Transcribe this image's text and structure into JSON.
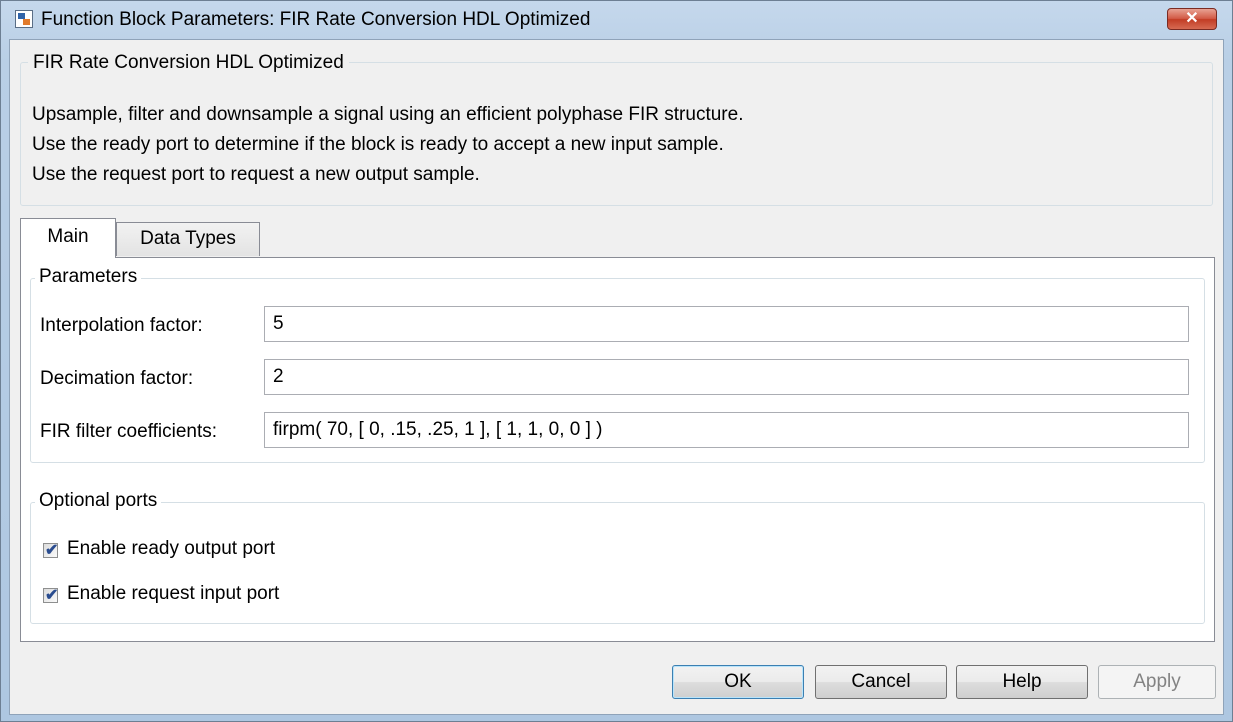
{
  "window": {
    "title": "Function Block Parameters: FIR Rate Conversion HDL Optimized",
    "close_label": "✕"
  },
  "description": {
    "group_title": "FIR Rate Conversion HDL Optimized",
    "lines": [
      "Upsample, filter and downsample a signal using an efficient polyphase FIR structure.",
      "Use the ready port to determine if the block is ready to accept a new input sample.",
      "Use the request port to request a new output sample."
    ]
  },
  "tabs": [
    {
      "label": "Main",
      "active": true
    },
    {
      "label": "Data Types",
      "active": false
    }
  ],
  "parameters": {
    "group_title": "Parameters",
    "interpolation": {
      "label": "Interpolation factor:",
      "value": "5"
    },
    "decimation": {
      "label": "Decimation factor:",
      "value": "2"
    },
    "coefficients": {
      "label": "FIR filter coefficients:",
      "value": "firpm( 70, [ 0, .15, .25, 1 ], [ 1, 1, 0, 0 ] )"
    }
  },
  "optional_ports": {
    "group_title": "Optional ports",
    "ready": {
      "label": "Enable ready output port",
      "checked": true
    },
    "request": {
      "label": "Enable request input port",
      "checked": true
    }
  },
  "buttons": {
    "ok": "OK",
    "cancel": "Cancel",
    "help": "Help",
    "apply": "Apply"
  },
  "icons": {
    "app": "simulink-block-icon",
    "close": "close-icon",
    "check": "checkmark-icon"
  },
  "colors": {
    "title_bar": "#b9cfe6",
    "close_button": "#c94d36",
    "client_bg": "#f0f0f0",
    "default_button_border": "#3c7fb1"
  }
}
